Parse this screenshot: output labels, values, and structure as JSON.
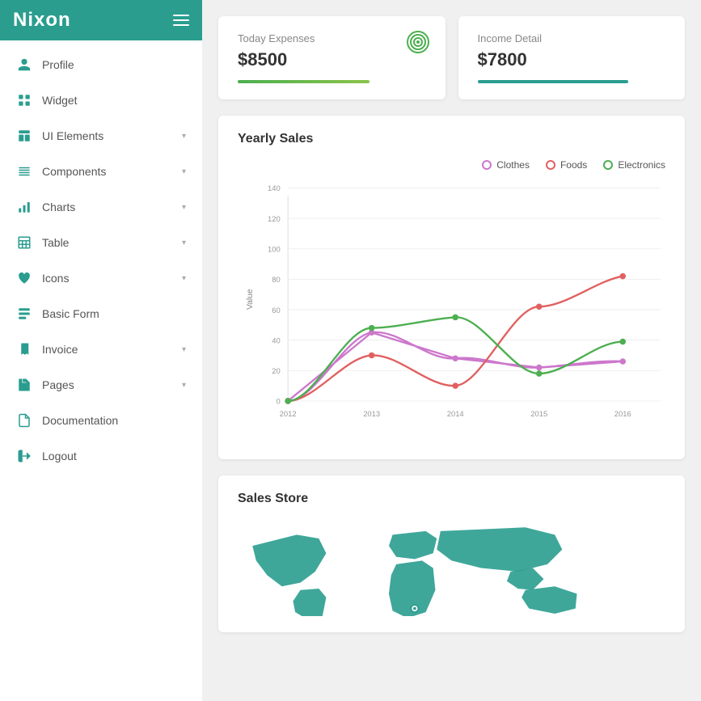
{
  "brand": {
    "logo": "Nixon",
    "color": "#2a9d8f"
  },
  "sidebar": {
    "items": [
      {
        "id": "profile",
        "label": "Profile",
        "icon": "person-icon",
        "hasChevron": false
      },
      {
        "id": "widget",
        "label": "Widget",
        "icon": "grid-icon",
        "hasChevron": false
      },
      {
        "id": "ui-elements",
        "label": "UI Elements",
        "icon": "layout-icon",
        "hasChevron": true
      },
      {
        "id": "components",
        "label": "Components",
        "icon": "components-icon",
        "hasChevron": true
      },
      {
        "id": "charts",
        "label": "Charts",
        "icon": "chart-icon",
        "hasChevron": true
      },
      {
        "id": "table",
        "label": "Table",
        "icon": "table-icon",
        "hasChevron": true
      },
      {
        "id": "icons",
        "label": "Icons",
        "icon": "heart-icon",
        "hasChevron": true
      },
      {
        "id": "basic-form",
        "label": "Basic Form",
        "icon": "form-icon",
        "hasChevron": false
      },
      {
        "id": "invoice",
        "label": "Invoice",
        "icon": "invoice-icon",
        "hasChevron": true
      },
      {
        "id": "pages",
        "label": "Pages",
        "icon": "pages-icon",
        "hasChevron": true
      },
      {
        "id": "documentation",
        "label": "Documentation",
        "icon": "doc-icon",
        "hasChevron": false
      },
      {
        "id": "logout",
        "label": "Logout",
        "icon": "logout-icon",
        "hasChevron": false
      }
    ]
  },
  "cards": [
    {
      "id": "today-expenses",
      "label": "Today Expenses",
      "value": "$8500",
      "barClass": "bar-green",
      "showTarget": true
    },
    {
      "id": "income-detail",
      "label": "Income Detail",
      "value": "$7800",
      "barClass": "bar-teal",
      "showTarget": false
    }
  ],
  "yearly_sales": {
    "title": "Yearly Sales",
    "legend": [
      {
        "label": "Clothes",
        "color": "#cc77cc",
        "borderColor": "#cc77cc"
      },
      {
        "label": "Foods",
        "color": "#e06060",
        "borderColor": "#e06060"
      },
      {
        "label": "Electronics",
        "color": "#4caf50",
        "borderColor": "#4caf50"
      }
    ],
    "yAxis": {
      "label": "Value",
      "ticks": [
        0,
        20,
        40,
        60,
        80,
        100,
        120,
        140
      ]
    },
    "xAxis": {
      "ticks": [
        "2012",
        "2013",
        "2014",
        "2015",
        "2016"
      ]
    }
  },
  "sales_store": {
    "title": "Sales Store"
  }
}
